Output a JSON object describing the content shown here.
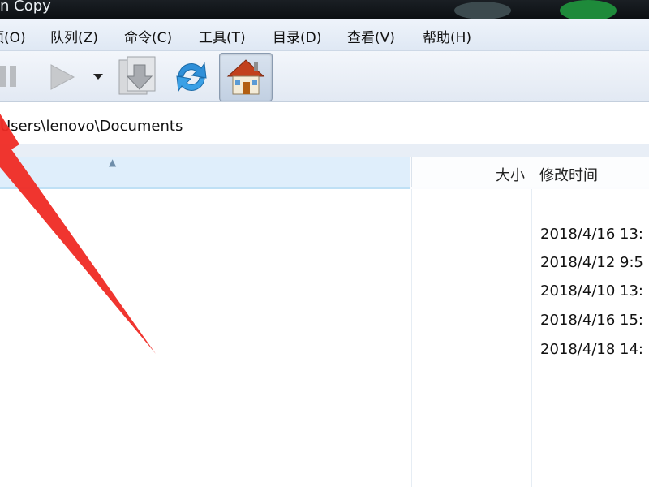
{
  "window": {
    "title": "n Copy"
  },
  "menu": [
    {
      "label": "项(O)"
    },
    {
      "label": "队列(Z)"
    },
    {
      "label": "命令(C)"
    },
    {
      "label": "工具(T)"
    },
    {
      "label": "目录(D)"
    },
    {
      "label": "查看(V)"
    },
    {
      "label": "帮助(H)"
    }
  ],
  "toolbar": {
    "icons": [
      "pause-icon",
      "play-icon",
      "dropdown-arrow-icon",
      "process-queue-icon",
      "refresh-icon",
      "home-icon"
    ]
  },
  "path": {
    "value": "Users\\lenovo\\Documents"
  },
  "file_list": {
    "columns": {
      "size": "大小",
      "modified": "修改时间"
    },
    "rows": [
      {
        "modified": "2018/4/16 13:"
      },
      {
        "modified": "2018/4/12 9:5"
      },
      {
        "modified": "2018/4/10 13:"
      },
      {
        "modified": "2018/4/16 15:"
      },
      {
        "modified": "2018/4/18 14:"
      }
    ]
  },
  "colors": {
    "annotation_arrow": "#ef2a24",
    "header_highlight": "#dfeefb"
  }
}
